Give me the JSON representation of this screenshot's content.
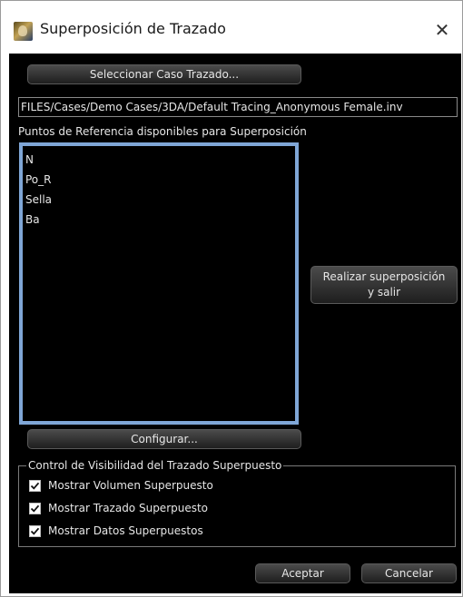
{
  "window": {
    "title": "Superposición de Trazado",
    "close_glyph": "✕",
    "app_icon": "tracing-app-icon"
  },
  "actions": {
    "select_case_label": "Seleccionar Caso Trazado...",
    "file_path": "FILES/Cases/Demo Cases/3DA/Default Tracing_Anonymous Female.inv",
    "configure_label": "Configurar...",
    "accept_label": "Aceptar",
    "cancel_label": "Cancelar"
  },
  "reference_points": {
    "label": "Puntos de Referencia disponibles para Superposición",
    "items": [
      "N",
      "Po_R",
      "Sella",
      "Ba"
    ]
  },
  "overlay_button": {
    "line1": "Realizar superposición",
    "line2": "y salir"
  },
  "visibility": {
    "title": "Control de Visibilidad del Trazado Superpuesto",
    "options": [
      {
        "label": "Mostrar Volumen Superpuesto",
        "checked": true
      },
      {
        "label": "Mostrar Trazado Superpuesto",
        "checked": true
      },
      {
        "label": "Mostrar Datos Superpuestos",
        "checked": true
      }
    ]
  },
  "colors": {
    "panel_bg": "#000000",
    "list_highlight_border": "#7fa6d6",
    "text": "#e6e6e6"
  }
}
